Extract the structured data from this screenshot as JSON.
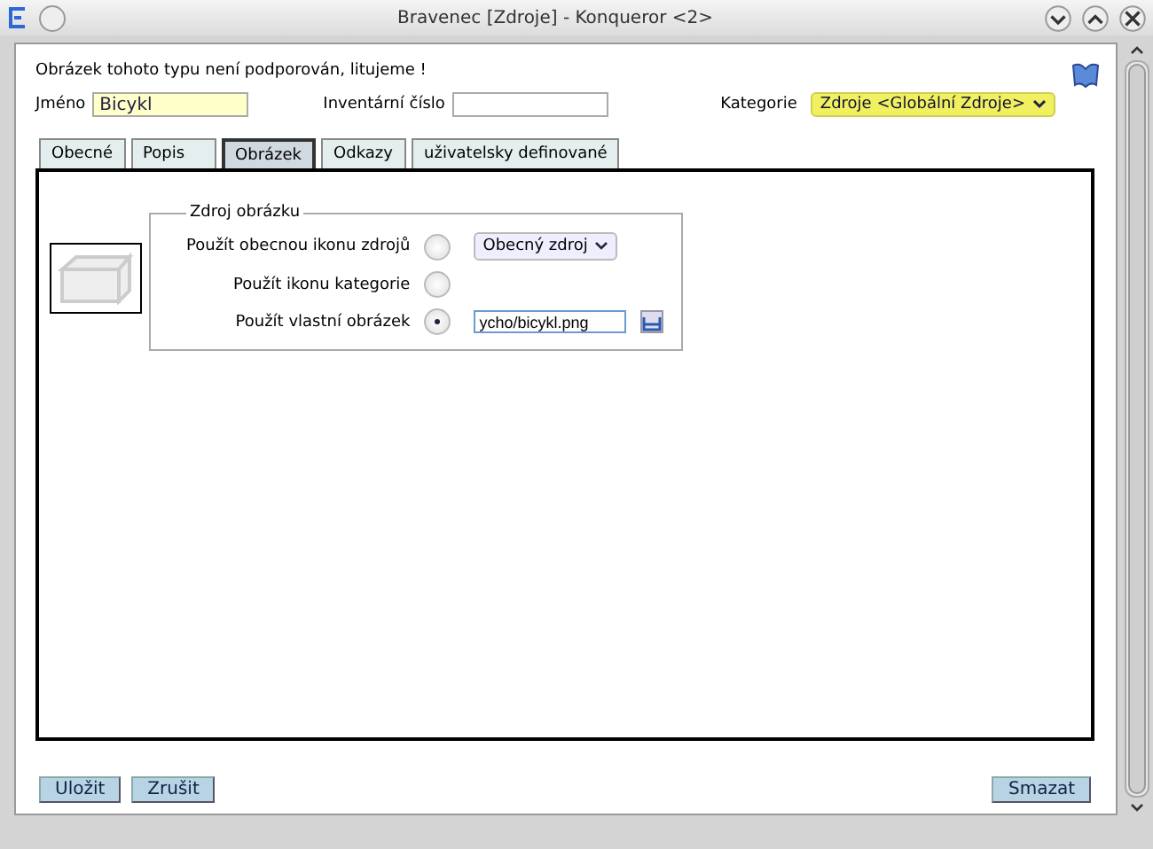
{
  "window": {
    "title": "Bravenec [Zdroje] - Konqueror <2>"
  },
  "message": "Obrázek tohoto typu není podporován, litujeme !",
  "name_field": {
    "label": "Jméno",
    "value": "Bicykl"
  },
  "inventory_field": {
    "label": "Inventární číslo"
  },
  "category": {
    "label": "Kategorie",
    "value": "Zdroje <Globální Zdroje>"
  },
  "tabs": [
    {
      "label": "Obecné",
      "selected": false
    },
    {
      "label": "Popis",
      "selected": false
    },
    {
      "label": "Obrázek",
      "selected": true
    },
    {
      "label": "Odkazy",
      "selected": false
    },
    {
      "label": "uživatelsky definované",
      "selected": false
    }
  ],
  "image_source": {
    "legend": "Zdroj obrázku",
    "options": [
      {
        "kind": "dropdown",
        "label": "Použít obecnou ikonu zdrojů",
        "selected": false,
        "value": "Obecný zdroj"
      },
      {
        "kind": "plain",
        "label": "Použít ikonu kategorie",
        "selected": false
      },
      {
        "kind": "file",
        "label": "Použít vlastní obrázek",
        "selected": true,
        "value": "ycho/bicykl.png"
      }
    ]
  },
  "buttons_left": [
    "Uložit",
    "Zrušit"
  ],
  "buttons_right": [
    "Smazat"
  ]
}
